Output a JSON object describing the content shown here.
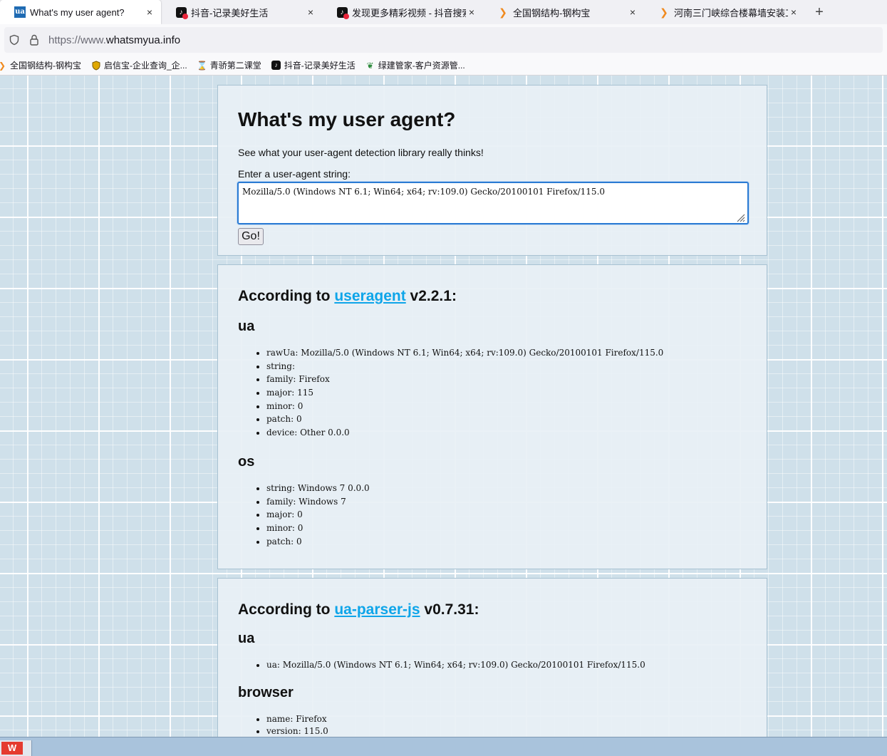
{
  "tabs": [
    {
      "title": "What's my user agent?",
      "favicon": "ua-favicon-icon",
      "active": true
    },
    {
      "title": "抖音-记录美好生活",
      "favicon": "tiktok-icon",
      "active": false
    },
    {
      "title": "发现更多精彩视频 - 抖音搜索",
      "favicon": "tiktok-icon",
      "active": false
    },
    {
      "title": "全国钢结构-钢构宝",
      "favicon": "ganggoubao-icon",
      "active": false
    },
    {
      "title": "河南三门峡综合楼幕墙安装工程",
      "favicon": "ganggoubao-icon",
      "active": false
    }
  ],
  "newtab_label": "+",
  "close_glyph": "×",
  "address": {
    "scheme": "https://www.",
    "host": "whatsmyua.info"
  },
  "bookmarks": [
    {
      "label": "全国钢结构-钢构宝",
      "icon": "ganggoubao-icon"
    },
    {
      "label": "启信宝-企业查询_企...",
      "icon": "qixinbao-icon"
    },
    {
      "label": "青骄第二课堂",
      "icon": "hourglass-icon"
    },
    {
      "label": "抖音-记录美好生活",
      "icon": "tiktok-icon"
    },
    {
      "label": "绿建管家-客户资源管...",
      "icon": "leaf-icon"
    }
  ],
  "form": {
    "heading": "What's my user agent?",
    "lead": "See what your user-agent detection library really thinks!",
    "input_label": "Enter a user-agent string:",
    "input_value": "Mozilla/5.0 (Windows NT 6.1; Win64; x64; rv:109.0) Gecko/20100101 Firefox/115.0",
    "go_label": "Go!"
  },
  "useragent": {
    "prefix": "According to ",
    "lib": "useragent",
    "suffix": " v2.2.1:",
    "ua_heading": "ua",
    "ua_items": [
      "rawUa: Mozilla/5.0 (Windows NT 6.1; Win64; x64; rv:109.0) Gecko/20100101 Firefox/115.0",
      "string:",
      "family: Firefox",
      "major: 115",
      "minor: 0",
      "patch: 0",
      "device: Other 0.0.0"
    ],
    "os_heading": "os",
    "os_items": [
      "string: Windows 7 0.0.0",
      "family: Windows 7",
      "major: 0",
      "minor: 0",
      "patch: 0"
    ]
  },
  "uaparser": {
    "prefix": "According to ",
    "lib": "ua-parser-js",
    "suffix": " v0.7.31:",
    "ua_heading": "ua",
    "ua_items": [
      "ua: Mozilla/5.0 (Windows NT 6.1; Win64; x64; rv:109.0) Gecko/20100101 Firefox/115.0"
    ],
    "browser_heading": "browser",
    "browser_items": [
      "name: Firefox",
      "version: 115.0"
    ]
  },
  "colors": {
    "link": "#0ea5e9",
    "focus": "#2b7bd3",
    "page_bg": "#cfe0ea"
  }
}
